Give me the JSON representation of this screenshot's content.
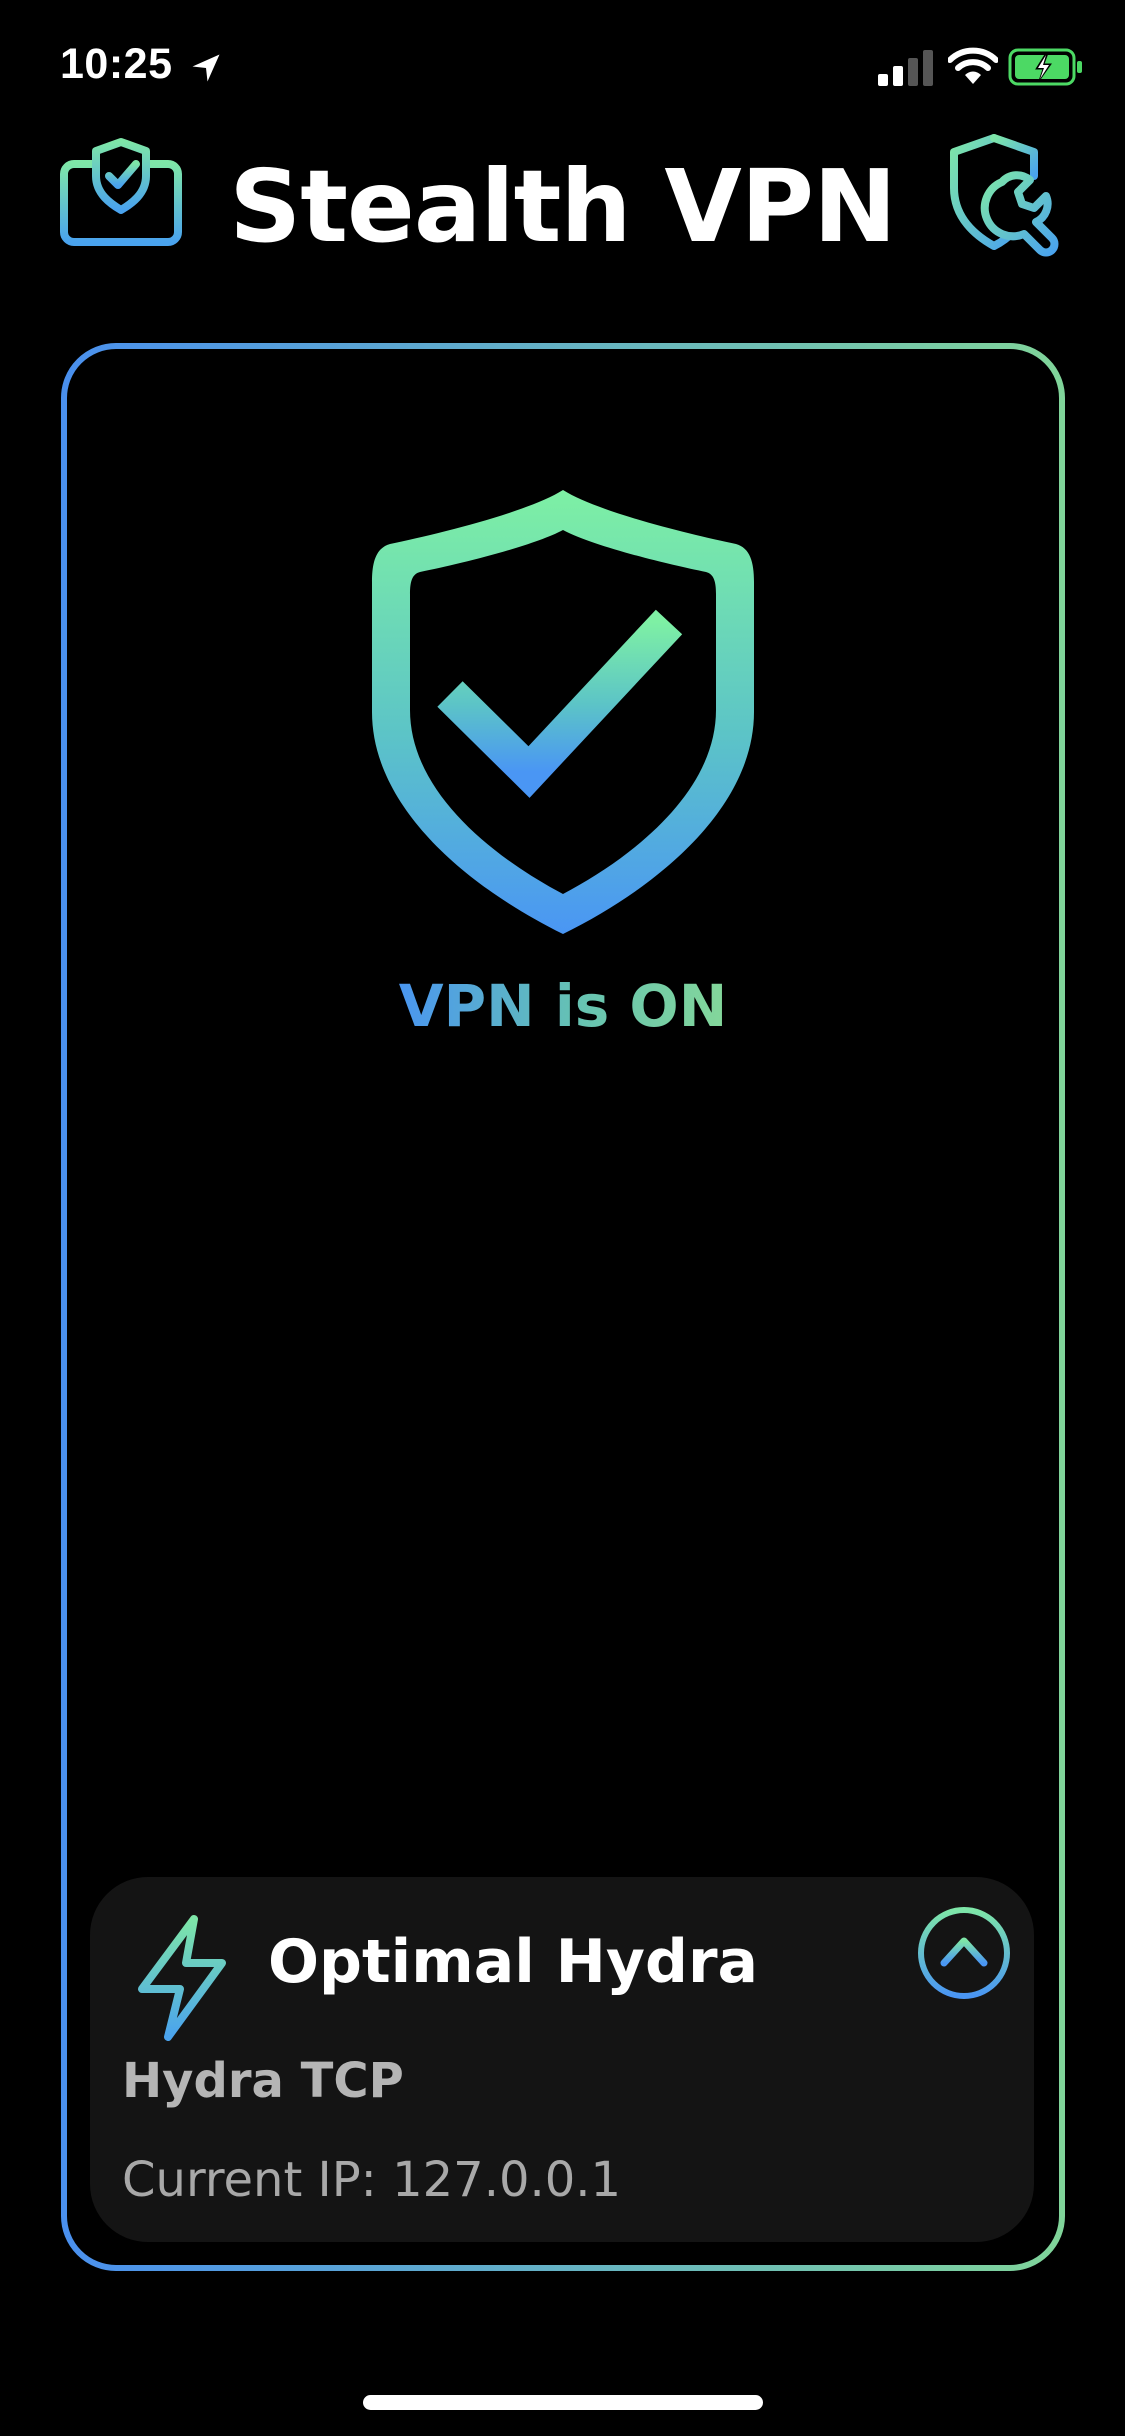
{
  "status_bar": {
    "time": "10:25",
    "icons": [
      "location-arrow-icon",
      "cellular-signal-icon",
      "wifi-icon",
      "battery-charging-icon"
    ]
  },
  "header": {
    "title": "Stealth VPN",
    "left_icon": "monitor-shield-icon",
    "right_icon": "shield-wrench-icon"
  },
  "main": {
    "hero_icon": "shield-check-icon",
    "status_text": "VPN is ON"
  },
  "server_panel": {
    "icon": "lightning-bolt-icon",
    "server_name": "Optimal Hydra",
    "protocol": "Hydra TCP",
    "current_ip": "Current IP: 127.0.0.1",
    "expand_icon": "chevron-up-icon"
  },
  "colors": {
    "background": "#000000",
    "panel": "#141414",
    "gradient_blue": "#4a96f0",
    "gradient_green": "#84d79a",
    "text_primary": "#ffffff",
    "text_secondary": "#b5b5b5",
    "battery_green": "#4cd964"
  }
}
